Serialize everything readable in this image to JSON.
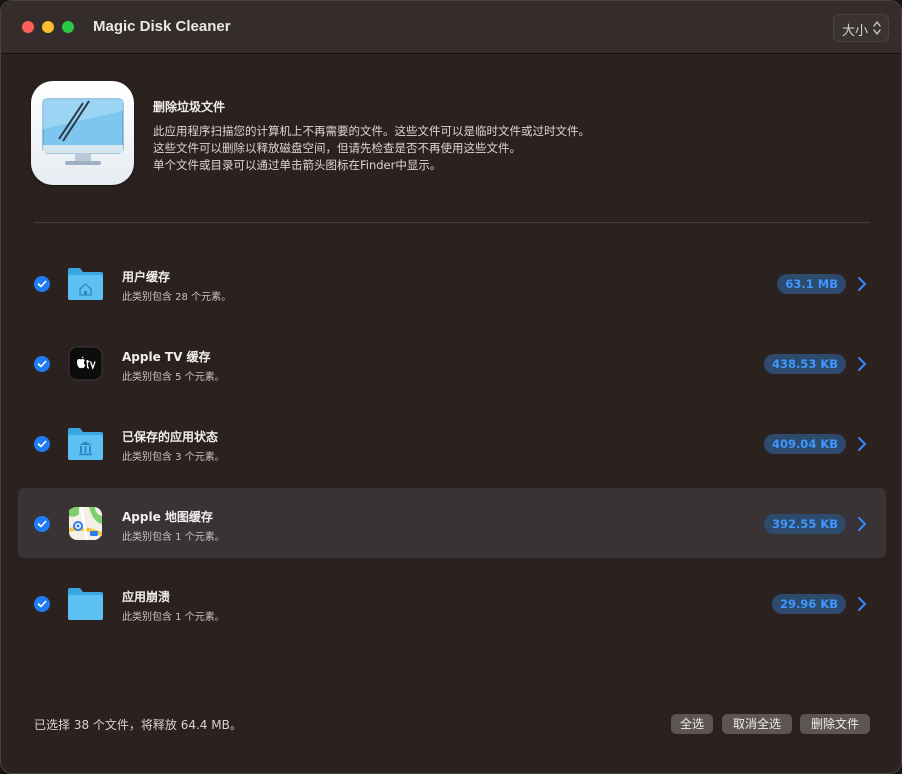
{
  "window": {
    "title": "Magic Disk Cleaner"
  },
  "sort": {
    "selected": "大小"
  },
  "header": {
    "title": "删除垃圾文件",
    "description": [
      "此应用程序扫描您的计算机上不再需要的文件。这些文件可以是临时文件或过时文件。",
      "这些文件可以删除以释放磁盘空间，但请先检查是否不再使用这些文件。",
      "单个文件或目录可以通过单击箭头图标在Finder中显示。"
    ]
  },
  "categories": [
    {
      "title": "用户缓存",
      "subtitle": "此类别包含 28 个元素。",
      "size": "63.1 MB",
      "icon": "home-folder-icon",
      "checked": true
    },
    {
      "title": "Apple TV 缓存",
      "subtitle": "此类别包含 5 个元素。",
      "size": "438.53 KB",
      "icon": "apple-tv-icon",
      "checked": true
    },
    {
      "title": "已保存的应用状态",
      "subtitle": "此类别包含 3 个元素。",
      "size": "409.04 KB",
      "icon": "building-folder-icon",
      "checked": true
    },
    {
      "title": "Apple 地图缓存",
      "subtitle": "此类别包含 1 个元素。",
      "size": "392.55 KB",
      "icon": "maps-icon",
      "checked": true
    },
    {
      "title": "应用崩溃",
      "subtitle": "此类别包含 1 个元素。",
      "size": "29.96 KB",
      "icon": "folder-icon",
      "checked": true
    }
  ],
  "footer": {
    "status": "已选择 38 个文件，将释放 64.4 MB。",
    "select_all": "全选",
    "deselect_all": "取消全选",
    "delete_files": "删除文件"
  },
  "colors": {
    "accent": "#1f7cf5",
    "badge_text": "#3e98ff",
    "badge_bg": "#2e4a6c",
    "background": "#2b2220"
  }
}
